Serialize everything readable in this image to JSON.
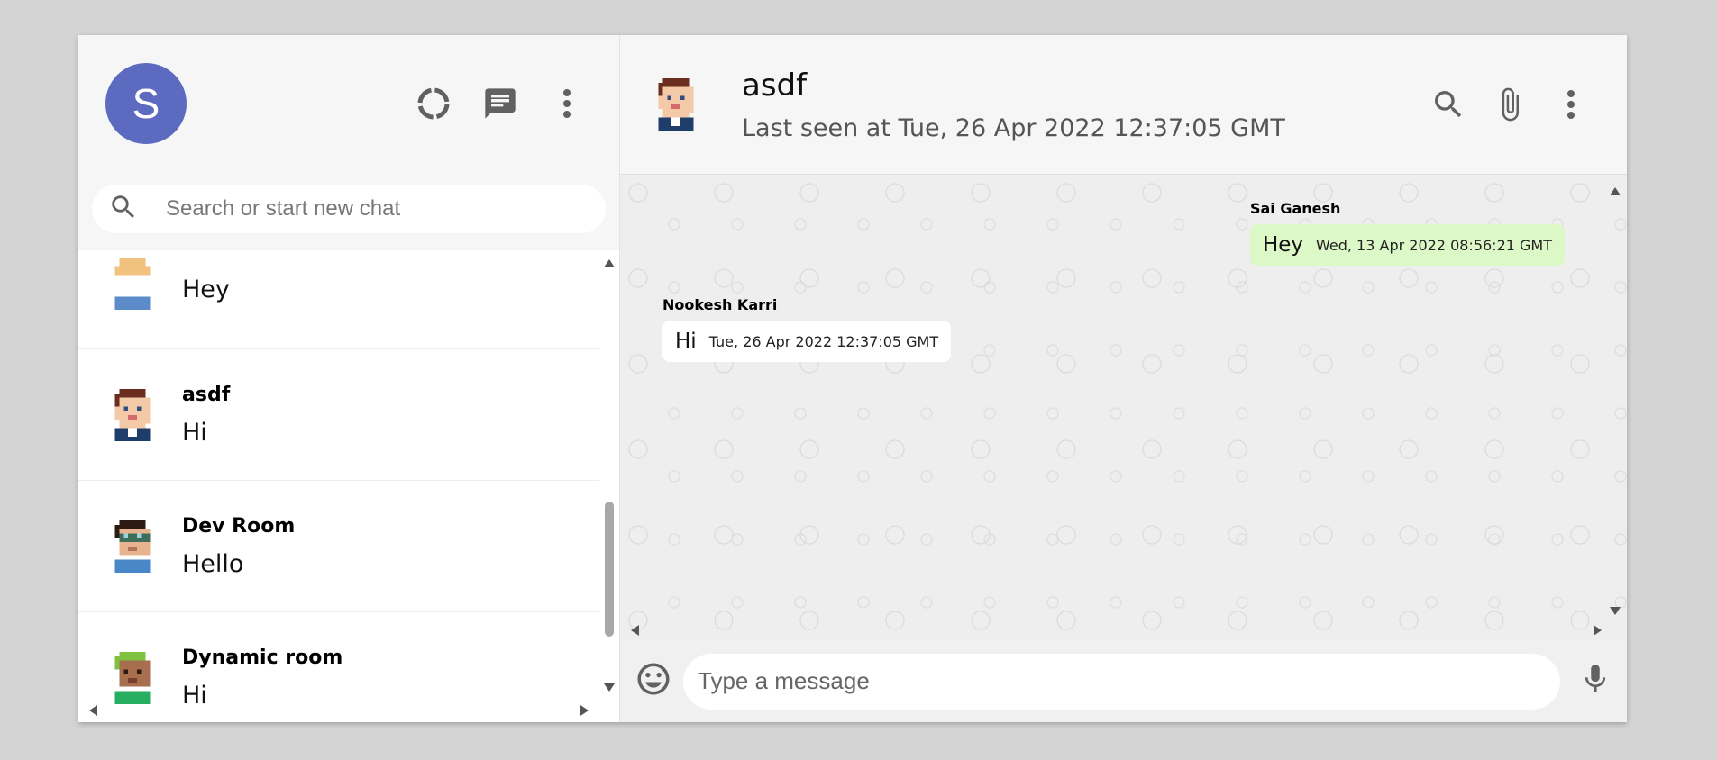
{
  "user": {
    "avatar_letter": "S"
  },
  "search": {
    "placeholder": "Search or start new chat"
  },
  "chat_list": [
    {
      "name": "",
      "last_message": "Hey"
    },
    {
      "name": "asdf",
      "last_message": "Hi"
    },
    {
      "name": "Dev Room",
      "last_message": "Hello"
    },
    {
      "name": "Dynamic room",
      "last_message": "Hi"
    }
  ],
  "active_chat": {
    "name": "asdf",
    "status": "Last seen at Tue, 26 Apr 2022 12:37:05 GMT"
  },
  "messages": [
    {
      "sender": "Sai Ganesh",
      "text": "Hey",
      "time": "Wed, 13 Apr 2022 08:56:21 GMT",
      "direction": "outgoing"
    },
    {
      "sender": "Nookesh Karri",
      "text": "Hi",
      "time": "Tue, 26 Apr 2022 12:37:05 GMT",
      "direction": "incoming"
    }
  ],
  "composer": {
    "placeholder": "Type a message"
  },
  "colors": {
    "avatar": "#5c6bc0",
    "outgoing_bubble": "#dcf8c6",
    "incoming_bubble": "#ffffff",
    "header_bg": "#f6f6f6",
    "icons": "#616161"
  },
  "icons": [
    "status-icon",
    "new-chat-icon",
    "menu-icon",
    "search-icon",
    "attach-icon",
    "emoji-icon",
    "mic-icon"
  ]
}
